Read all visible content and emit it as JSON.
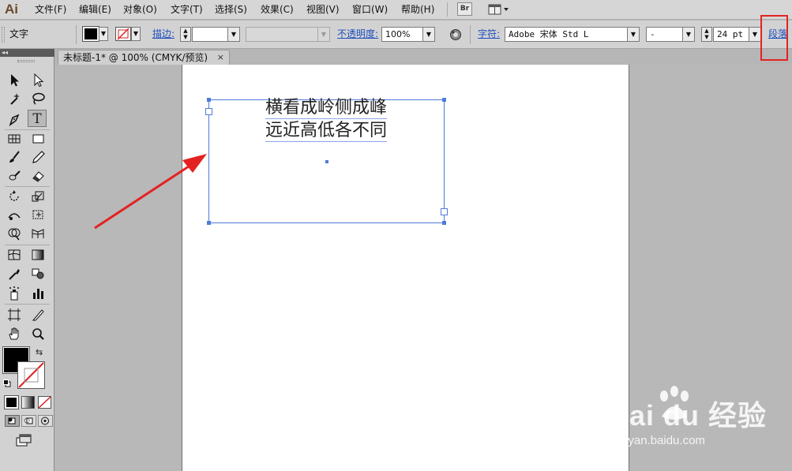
{
  "app": {
    "logo": "Ai"
  },
  "menu": {
    "items": [
      {
        "label": "文件(F)"
      },
      {
        "label": "编辑(E)"
      },
      {
        "label": "对象(O)"
      },
      {
        "label": "文字(T)"
      },
      {
        "label": "选择(S)"
      },
      {
        "label": "效果(C)"
      },
      {
        "label": "视图(V)"
      },
      {
        "label": "窗口(W)"
      },
      {
        "label": "帮助(H)"
      }
    ],
    "bridge_label": "Br"
  },
  "control_bar": {
    "tool_name": "文字",
    "stroke_label": "描边",
    "stroke_value": "",
    "style_value": "",
    "opacity_label": "不透明度",
    "opacity_value": "100%",
    "character_label": "字符",
    "font_family": "Adobe 宋体 Std L",
    "font_style": "-",
    "font_size": "24 pt",
    "paragraph_label": "段落"
  },
  "colors": {
    "fill": "#000000",
    "stroke": "none",
    "selection": "#4f7bd9",
    "annotation": "#e42222"
  },
  "tools_panel": {
    "header": "◂◂",
    "tools": [
      "selection-tool",
      "direct-selection-tool",
      "magic-wand-tool",
      "lasso-tool",
      "pen-tool",
      "type-tool",
      "line-segment-tool",
      "rectangle-tool",
      "paintbrush-tool",
      "pencil-tool",
      "blob-brush-tool",
      "eraser-tool",
      "rotate-tool",
      "scale-tool",
      "width-tool",
      "free-transform-tool",
      "shape-builder-tool",
      "perspective-grid-tool",
      "mesh-tool",
      "gradient-tool",
      "eyedropper-tool",
      "blend-tool",
      "symbol-sprayer-tool",
      "column-graph-tool",
      "artboard-tool",
      "slice-tool",
      "hand-tool",
      "zoom-tool"
    ],
    "active_tool": "type-tool"
  },
  "document": {
    "tab_title": "未标题-1* @ 100% (CMYK/预览)",
    "close_glyph": "×"
  },
  "text_content": {
    "line1": "横看成岭侧成峰",
    "line2": "远近高低各不同"
  },
  "watermark": {
    "main": "Bai du 经验",
    "sub": "jingyan.baidu.com"
  }
}
